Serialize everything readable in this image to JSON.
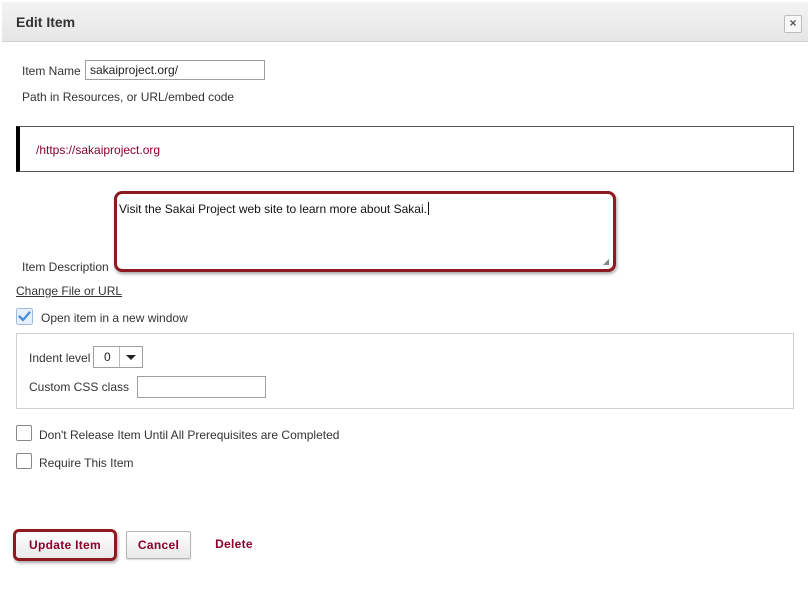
{
  "dialog": {
    "title": "Edit Item",
    "close_symbol": "×"
  },
  "form": {
    "item_name_label": "Item Name",
    "item_name_value": "sakaiproject.org/",
    "path_label": "Path in Resources, or URL/embed code",
    "url_value": "/https://sakaiproject.org",
    "description_label": "Item Description",
    "description_value": "Visit the Sakai Project web site to learn more about Sakai.",
    "change_link": "Change File or URL",
    "open_new_window_label": "Open item in a new window",
    "open_new_window_checked": true,
    "indent_label": "Indent level",
    "indent_value": "0",
    "css_label": "Custom CSS class",
    "css_value": "",
    "prereq_label": "Don't Release Item Until All Prerequisites are Completed",
    "prereq_checked": false,
    "require_label": "Require This Item",
    "require_checked": false
  },
  "buttons": {
    "update": "Update Item",
    "cancel": "Cancel",
    "delete": "Delete"
  },
  "colors": {
    "accent": "#8b0029",
    "highlight_outline": "#8e1a1f",
    "check_blue": "#4a90d9"
  }
}
